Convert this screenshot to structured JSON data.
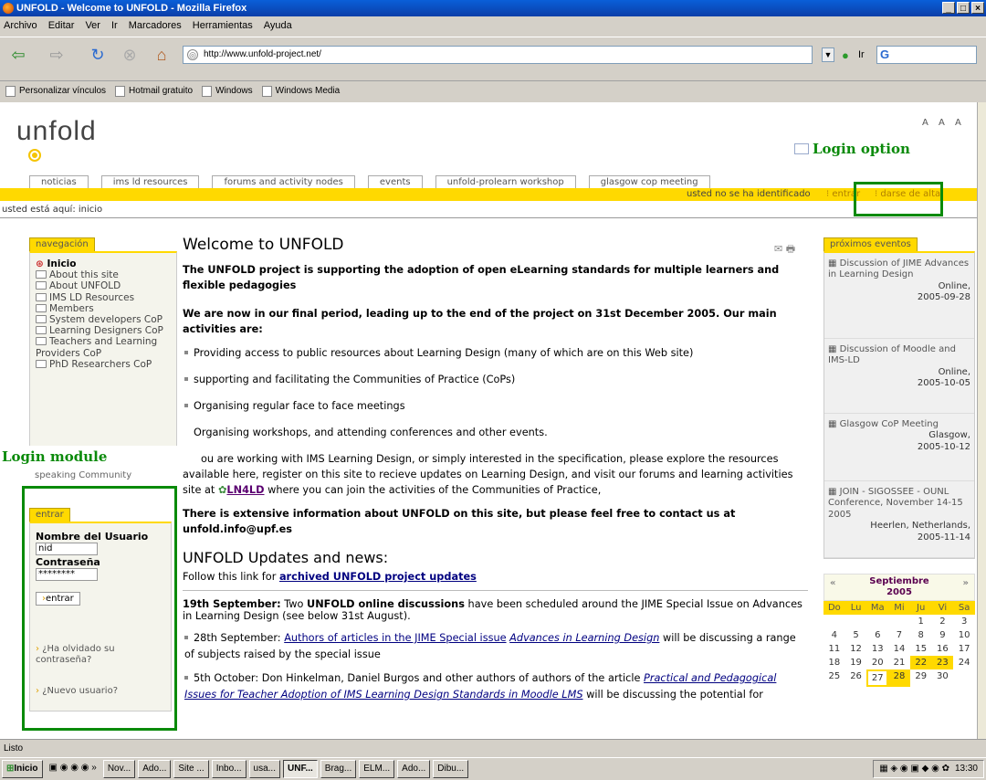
{
  "window": {
    "title": "UNFOLD - Welcome to UNFOLD - Mozilla Firefox",
    "controls": [
      "_",
      "×"
    ]
  },
  "menu": [
    "Archivo",
    "Editar",
    "Ver",
    "Ir",
    "Marcadores",
    "Herramientas",
    "Ayuda"
  ],
  "toolbar": {
    "url": "http://www.unfold-project.net/",
    "go_label": "Ir"
  },
  "bookmarks": [
    "Personalizar vínculos",
    "Hotmail gratuito",
    "Windows",
    "Windows Media"
  ],
  "site": {
    "logo": "unfold",
    "font_sizes": "A A A",
    "tabs": [
      "noticias",
      "ims ld resources",
      "forums and activity nodes",
      "events",
      "unfold-prolearn workshop",
      "glasgow cop meeting"
    ],
    "login_status": "usted no se ha identificado",
    "login_links": [
      "entrar",
      "darse de alta"
    ],
    "breadcrumb": "usted está aquí: inicio"
  },
  "navigation": {
    "header": "navegación",
    "items": [
      "Inicio",
      "About this site",
      "About UNFOLD",
      "IMS LD Resources",
      "Members",
      "System developers CoP",
      "Learning Designers CoP",
      "Teachers and Learning Providers CoP",
      "PhD Researchers CoP"
    ],
    "partial_item": "speaking Community"
  },
  "login": {
    "header": "entrar",
    "user_label": "Nombre del Usuario",
    "user_value": "nid",
    "pass_label": "Contraseña",
    "pass_value": "********",
    "submit": "entrar",
    "forgot": "¿Ha olvidado su contraseña?",
    "new_user": "¿Nuevo usuario?"
  },
  "annotations": {
    "login_option": "Login option",
    "login_module": "Login module"
  },
  "main": {
    "title": "Welcome to UNFOLD",
    "intro": "The UNFOLD project is supporting the adoption of open eLearning standards for multiple learners and flexible pedagogies",
    "final_period": "We are now in our final period, leading up to the end of the project on 31st December 2005. Our main activities are:",
    "activities": [
      "Providing access to public resources about Learning Design (many of which are on this Web site)",
      "supporting and facilitating the Communities of Practice (CoPs)",
      "Organising regular face to face meetings",
      "Organising workshops, and attending conferences and other events."
    ],
    "para_part1": "ou are working with IMS Learning Design, or simply interested in the specification, please explore the resources available here, register on this site to recieve updates on Learning Design, and visit our forums and learning activities site at",
    "ln4ld": "LN4LD",
    "para_part2": "where you can join the activities of the Communities of Practice,",
    "contact": "There is extensive information about UNFOLD on this site, but please feel free to contact us at",
    "email": "unfold.info@upf.es",
    "news_title": "UNFOLD Updates and news:",
    "follow": "Follow this link for",
    "archived": "archived UNFOLD project updates",
    "news_date": "19th September:",
    "news_t1": "Two",
    "news_b1": "UNFOLD online discussions",
    "news_t2": "have been scheduled around the JIME Special Issue on Advances in Learning Design (see below 31st August).",
    "b1_date": "28th September:",
    "b1_link": "Authors of articles in the JIME Special issue",
    "b1_italic": "Advances in Learning Design",
    "b1_rest": "will be discussing a range of subjects raised by the special issue",
    "b2_start": "5th October: Don Hinkelman, Daniel Burgos and other authors of authors of the article",
    "b2_italic": "Practical and Pedagogical Issues for Teacher Adoption of IMS Learning Design Standards in Moodle LMS",
    "b2_rest": "will be discussing the potential for"
  },
  "events": {
    "header": "próximos eventos",
    "items": [
      {
        "title": "Discussion of JIME Advances in Learning Design",
        "place": "Online,",
        "date": "2005-09-28"
      },
      {
        "title": "Discussion of Moodle and IMS-LD",
        "place": "Online,",
        "date": "2005-10-05"
      },
      {
        "title": "Glasgow CoP Meeting",
        "place": "Glasgow,",
        "date": "2005-10-12"
      },
      {
        "title": "JOIN - SIGOSSEE - OUNL Conference, November 14-15 2005",
        "place": "Heerlen, Netherlands,",
        "date": "2005-11-14"
      }
    ]
  },
  "calendar": {
    "month": "Septiembre",
    "year": "2005",
    "prev": "«",
    "next": "»",
    "days": [
      "Do",
      "Lu",
      "Ma",
      "Mi",
      "Ju",
      "Vi",
      "Sa"
    ],
    "cells": [
      "",
      "",
      "",
      "",
      "1",
      "2",
      "3",
      "4",
      "5",
      "6",
      "7",
      "8",
      "9",
      "10",
      "11",
      "12",
      "13",
      "14",
      "15",
      "16",
      "17",
      "18",
      "19",
      "20",
      "21",
      "22",
      "23",
      "24",
      "25",
      "26",
      "27",
      "28",
      "29",
      "30",
      ""
    ],
    "highlighted": [
      "22",
      "23",
      "28"
    ],
    "today": "27"
  },
  "status": "Listo",
  "taskbar": {
    "start": "Inicio",
    "items": [
      "Nov...",
      "Ado...",
      "Site ...",
      "Inbo...",
      "usa...",
      "UNF...",
      "Brag...",
      "ELM...",
      "Ado...",
      "Dibu..."
    ],
    "active": "UNF...",
    "clock": "13:30"
  }
}
